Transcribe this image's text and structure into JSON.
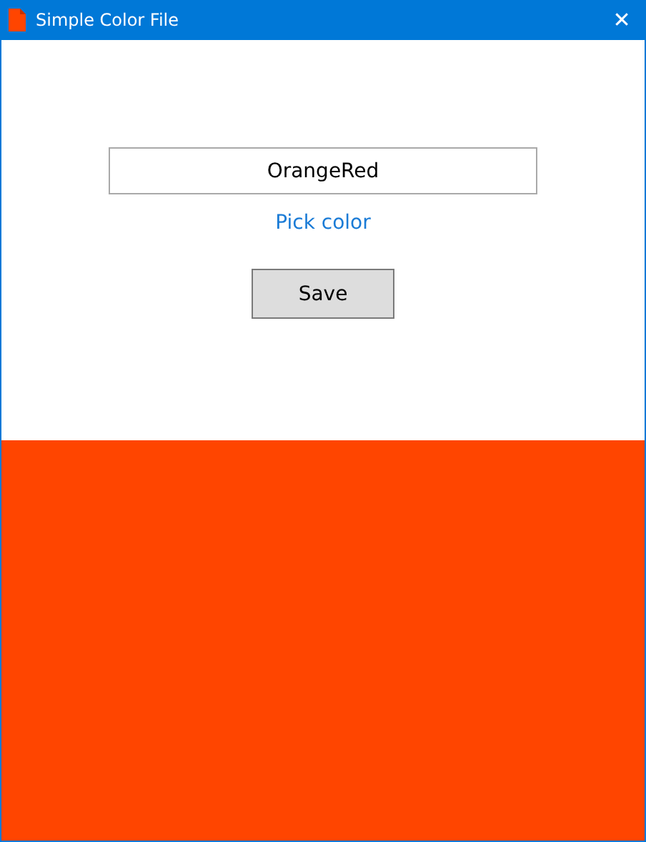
{
  "window": {
    "title": "Simple Color File",
    "close": "✕"
  },
  "color_name_field": {
    "value": "OrangeRed"
  },
  "pick_color_link": "Pick color",
  "save_button": "Save",
  "preview": {
    "color": "#ff4500"
  }
}
